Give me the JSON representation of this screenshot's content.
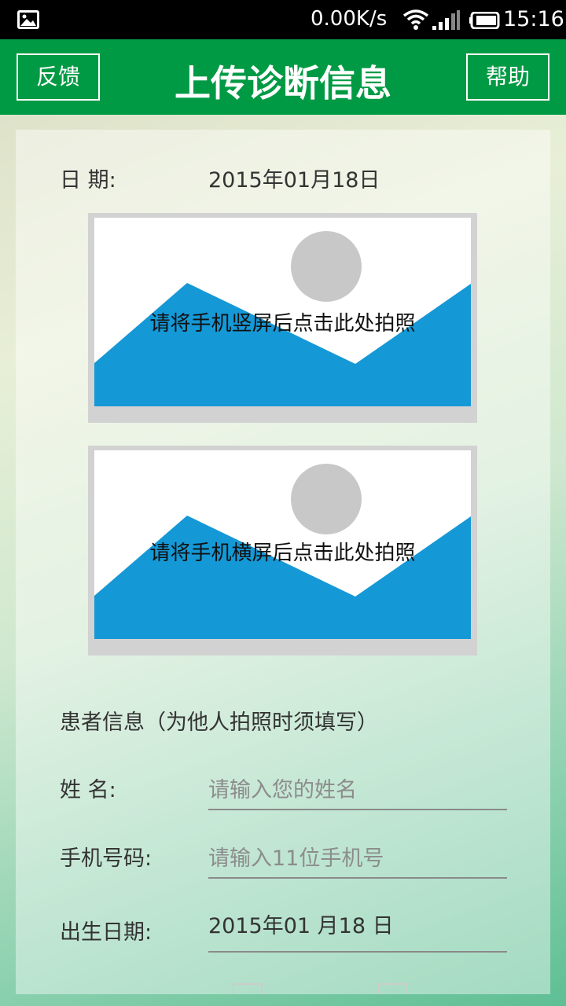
{
  "status_bar": {
    "net_speed": "0.00K/s",
    "time": "15:16",
    "icons": [
      "gallery-icon",
      "wifi-icon",
      "signal-icon",
      "battery-icon"
    ]
  },
  "header": {
    "title": "上传诊断信息",
    "left_button": "反馈",
    "right_button": "帮助",
    "background": "#009a44"
  },
  "form": {
    "date_label": "日 期:",
    "date_value": "2015年01月18日",
    "photo_portrait_caption": "请将手机竖屏后点击此处拍照",
    "photo_landscape_caption": "请将手机横屏后点击此处拍照",
    "patient_section_title": "患者信息（为他人拍照时须填写）",
    "name_label": "姓 名:",
    "name_placeholder": "请输入您的姓名",
    "name_value": "",
    "phone_label": "手机号码:",
    "phone_placeholder": "请输入11位手机号",
    "phone_value": "",
    "birth_label": "出生日期:",
    "birth_value": "2015年01 月18 日"
  },
  "colors": {
    "photo_blue": "#1598d6",
    "photo_sun": "#c8c8c8"
  }
}
